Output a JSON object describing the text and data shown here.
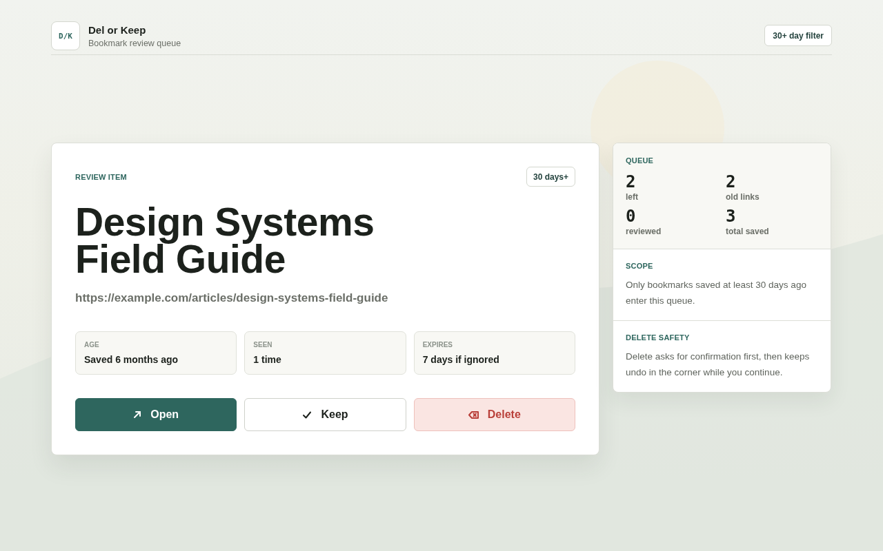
{
  "app": {
    "logo": "D/K",
    "title": "Del or Keep",
    "subtitle": "Bookmark review queue",
    "filter_button": "30+ day filter"
  },
  "review_item": {
    "label": "REVIEW ITEM",
    "badge": "30 days+",
    "title": "Design Systems Field Guide",
    "url": "https://example.com/articles/design-systems-field-guide",
    "meta": [
      {
        "label": "AGE",
        "value": "Saved 6 months ago"
      },
      {
        "label": "SEEN",
        "value": "1 time"
      },
      {
        "label": "EXPIRES",
        "value": "7 days if ignored"
      }
    ],
    "actions": [
      {
        "kind": "open",
        "label": "Open"
      },
      {
        "kind": "keep",
        "label": "Keep"
      },
      {
        "kind": "delete",
        "label": "Delete"
      }
    ]
  },
  "sidebar": {
    "queue": {
      "heading": "QUEUE",
      "stats": [
        {
          "value": "2",
          "label": "left"
        },
        {
          "value": "2",
          "label": "old links"
        },
        {
          "value": "0",
          "label": "reviewed"
        },
        {
          "value": "3",
          "label": "total saved"
        }
      ]
    },
    "notes": [
      {
        "heading": "SCOPE",
        "text": "Only bookmarks saved at least 30 days ago enter this queue."
      },
      {
        "heading": "DELETE SAFETY",
        "text": "Delete asks for confirmation first, then keeps undo in the corner while you continue."
      }
    ]
  }
}
